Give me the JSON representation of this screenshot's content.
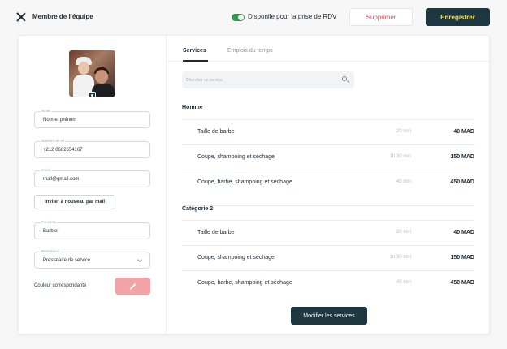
{
  "header": {
    "title": "Membre de l’équipe",
    "availability_label": "Disponile pour la prise de RDV",
    "availability_on": true,
    "delete_label": "Supprimer",
    "save_label": "Enregistrer"
  },
  "profile": {
    "name": {
      "label": "NOM",
      "value": "Nom et prénom"
    },
    "phone": {
      "label": "Numéro de tél",
      "value": "+212 0662654167"
    },
    "email": {
      "label": "email",
      "value": "mail@gmail.com"
    },
    "invite_label": "Inviter à nouveau par mail",
    "position": {
      "label": "Fonction",
      "value": "Barbier"
    },
    "permission": {
      "label": "Permission",
      "value": "Prestataire de service"
    },
    "color_label": "Couleur correspondante",
    "color": "#f2a3a5"
  },
  "tabs": [
    {
      "label": "Services",
      "active": true
    },
    {
      "label": "Emplois du temps",
      "active": false
    }
  ],
  "search": {
    "placeholder": "Chercher un service"
  },
  "groups": [
    {
      "title": "Homme",
      "services": [
        {
          "name": "Taille de barbe",
          "duration": "20 min",
          "price": "40 MAD"
        },
        {
          "name": "Coupe, shampoing et séchage",
          "duration": "1h 30 min",
          "price": "150 MAD"
        },
        {
          "name": "Coupe, barbe, shampoing et séchage",
          "duration": "45 min",
          "price": "450 MAD"
        }
      ]
    },
    {
      "title": "Catégorie 2",
      "services": [
        {
          "name": "Taille de barbe",
          "duration": "20 min",
          "price": "40 MAD"
        },
        {
          "name": "Coupe, shampoing et séchage",
          "duration": "1h 30 min",
          "price": "150 MAD"
        },
        {
          "name": "Coupe, barbe, shampoing et séchage",
          "duration": "45 min",
          "price": "450 MAD"
        }
      ]
    }
  ],
  "modify_label": "Modifier les services",
  "colors": {
    "accent": "#1d3640",
    "save_text": "#f3e24a",
    "delete_text": "#e5484d",
    "toggle": "#2e9e4a"
  }
}
